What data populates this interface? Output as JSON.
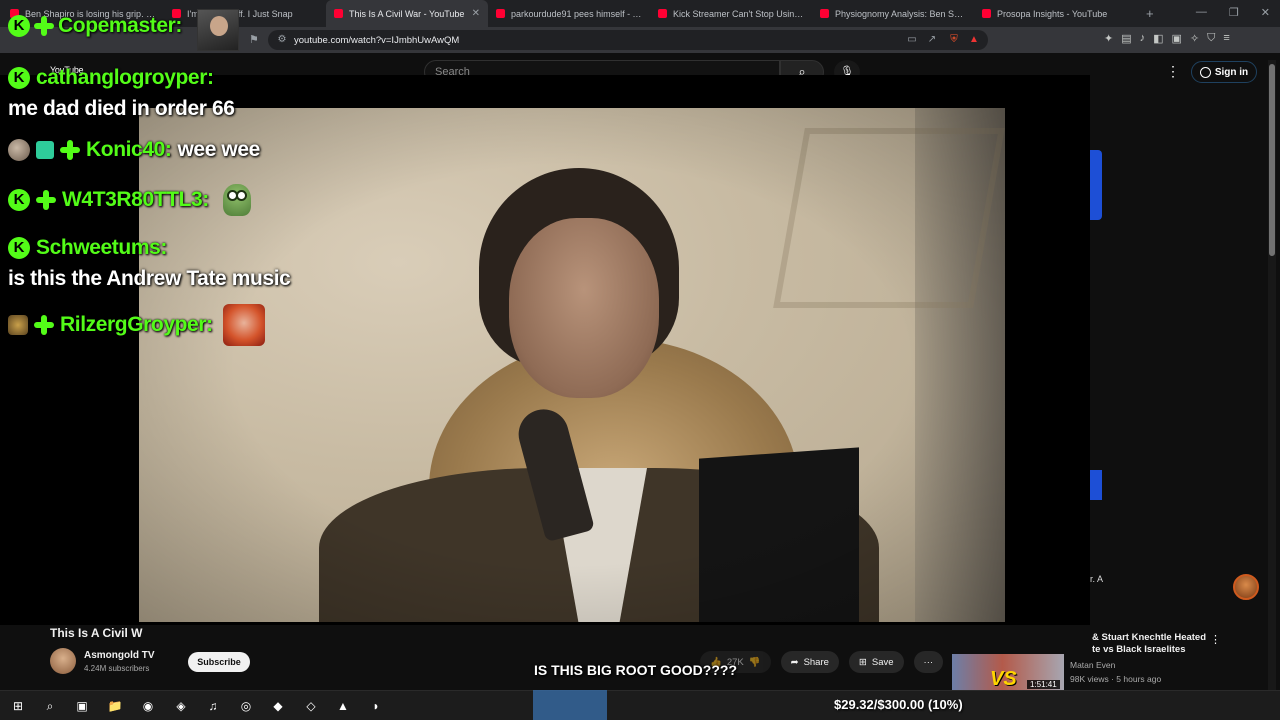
{
  "browser": {
    "tabs": [
      {
        "title": "Ben Shapiro is losing his grip. - You",
        "fav_color": "#ff0033",
        "active": false
      },
      {
        "title": "I'm Pissed Off. I Just Snap",
        "fav_color": "#ff0033",
        "active": false
      },
      {
        "title": "This Is A Civil War - YouTube",
        "fav_color": "#ff0033",
        "active": true
      },
      {
        "title": "parkourdude91 pees himself - YouTu",
        "fav_color": "#ff0033",
        "active": false
      },
      {
        "title": "Kick Streamer Can't Stop Using The",
        "fav_color": "#ff0033",
        "active": false
      },
      {
        "title": "Physiognomy Analysis: Ben Shapiro",
        "fav_color": "#ff0033",
        "active": false
      },
      {
        "title": "Prosopa Insights - YouTube",
        "fav_color": "#ff0033",
        "active": false
      }
    ],
    "url": "youtube.com/watch?v=IJmbhUwAwQM",
    "new_tab_icon": "+",
    "close_tab_icon": "✕",
    "window_controls": [
      "—",
      "❐",
      "✕"
    ]
  },
  "youtube": {
    "logo": "YouTube",
    "search_placeholder": "Search",
    "search_icon": "⌕",
    "mic_icon": "🎙",
    "more_icon": "⋮",
    "sign_in": "Sign in",
    "video_title": "This Is A Civil W",
    "channel_name": "Asmongold TV",
    "channel_subs": "4.24M subscribers",
    "subscribe": "Subscribe",
    "likes": "27K",
    "share": "Share",
    "save": "Save",
    "more_actions": "···"
  },
  "stream": {
    "header_user": "Copemaster:",
    "caption": "IS THIS BIG ROOT GOOD????",
    "goal": "$29.32/$300.00 (10%)",
    "k_letter": "K",
    "brand_color": "#53fc18",
    "messages": [
      {
        "user": "cathanglogroyper:",
        "text": "me dad died in order 66"
      },
      {
        "user": "Konic40:",
        "text": "wee wee"
      },
      {
        "user": "W4T3R80TTL3:",
        "text": ""
      },
      {
        "user": "Schweetums:",
        "text": "is this the Andrew Tate music"
      },
      {
        "user": "RilzergGroyper:",
        "text": ""
      }
    ]
  },
  "sidebar": {
    "rec_title": "& Stuart Knechtle Heated\nte vs Black Israelites",
    "rec_channel": "Matan Even",
    "rec_meta": "98K views · 5 hours ago",
    "rec_duration": "1:51:41",
    "rec_vs": "VS",
    "side_text": "r. A"
  },
  "taskbar": {
    "icons": [
      "⊞",
      "⌕",
      "▣",
      "📁",
      "◉",
      "◈",
      "♫",
      "◎",
      "◆",
      "◇",
      "▲",
      "◗"
    ]
  }
}
